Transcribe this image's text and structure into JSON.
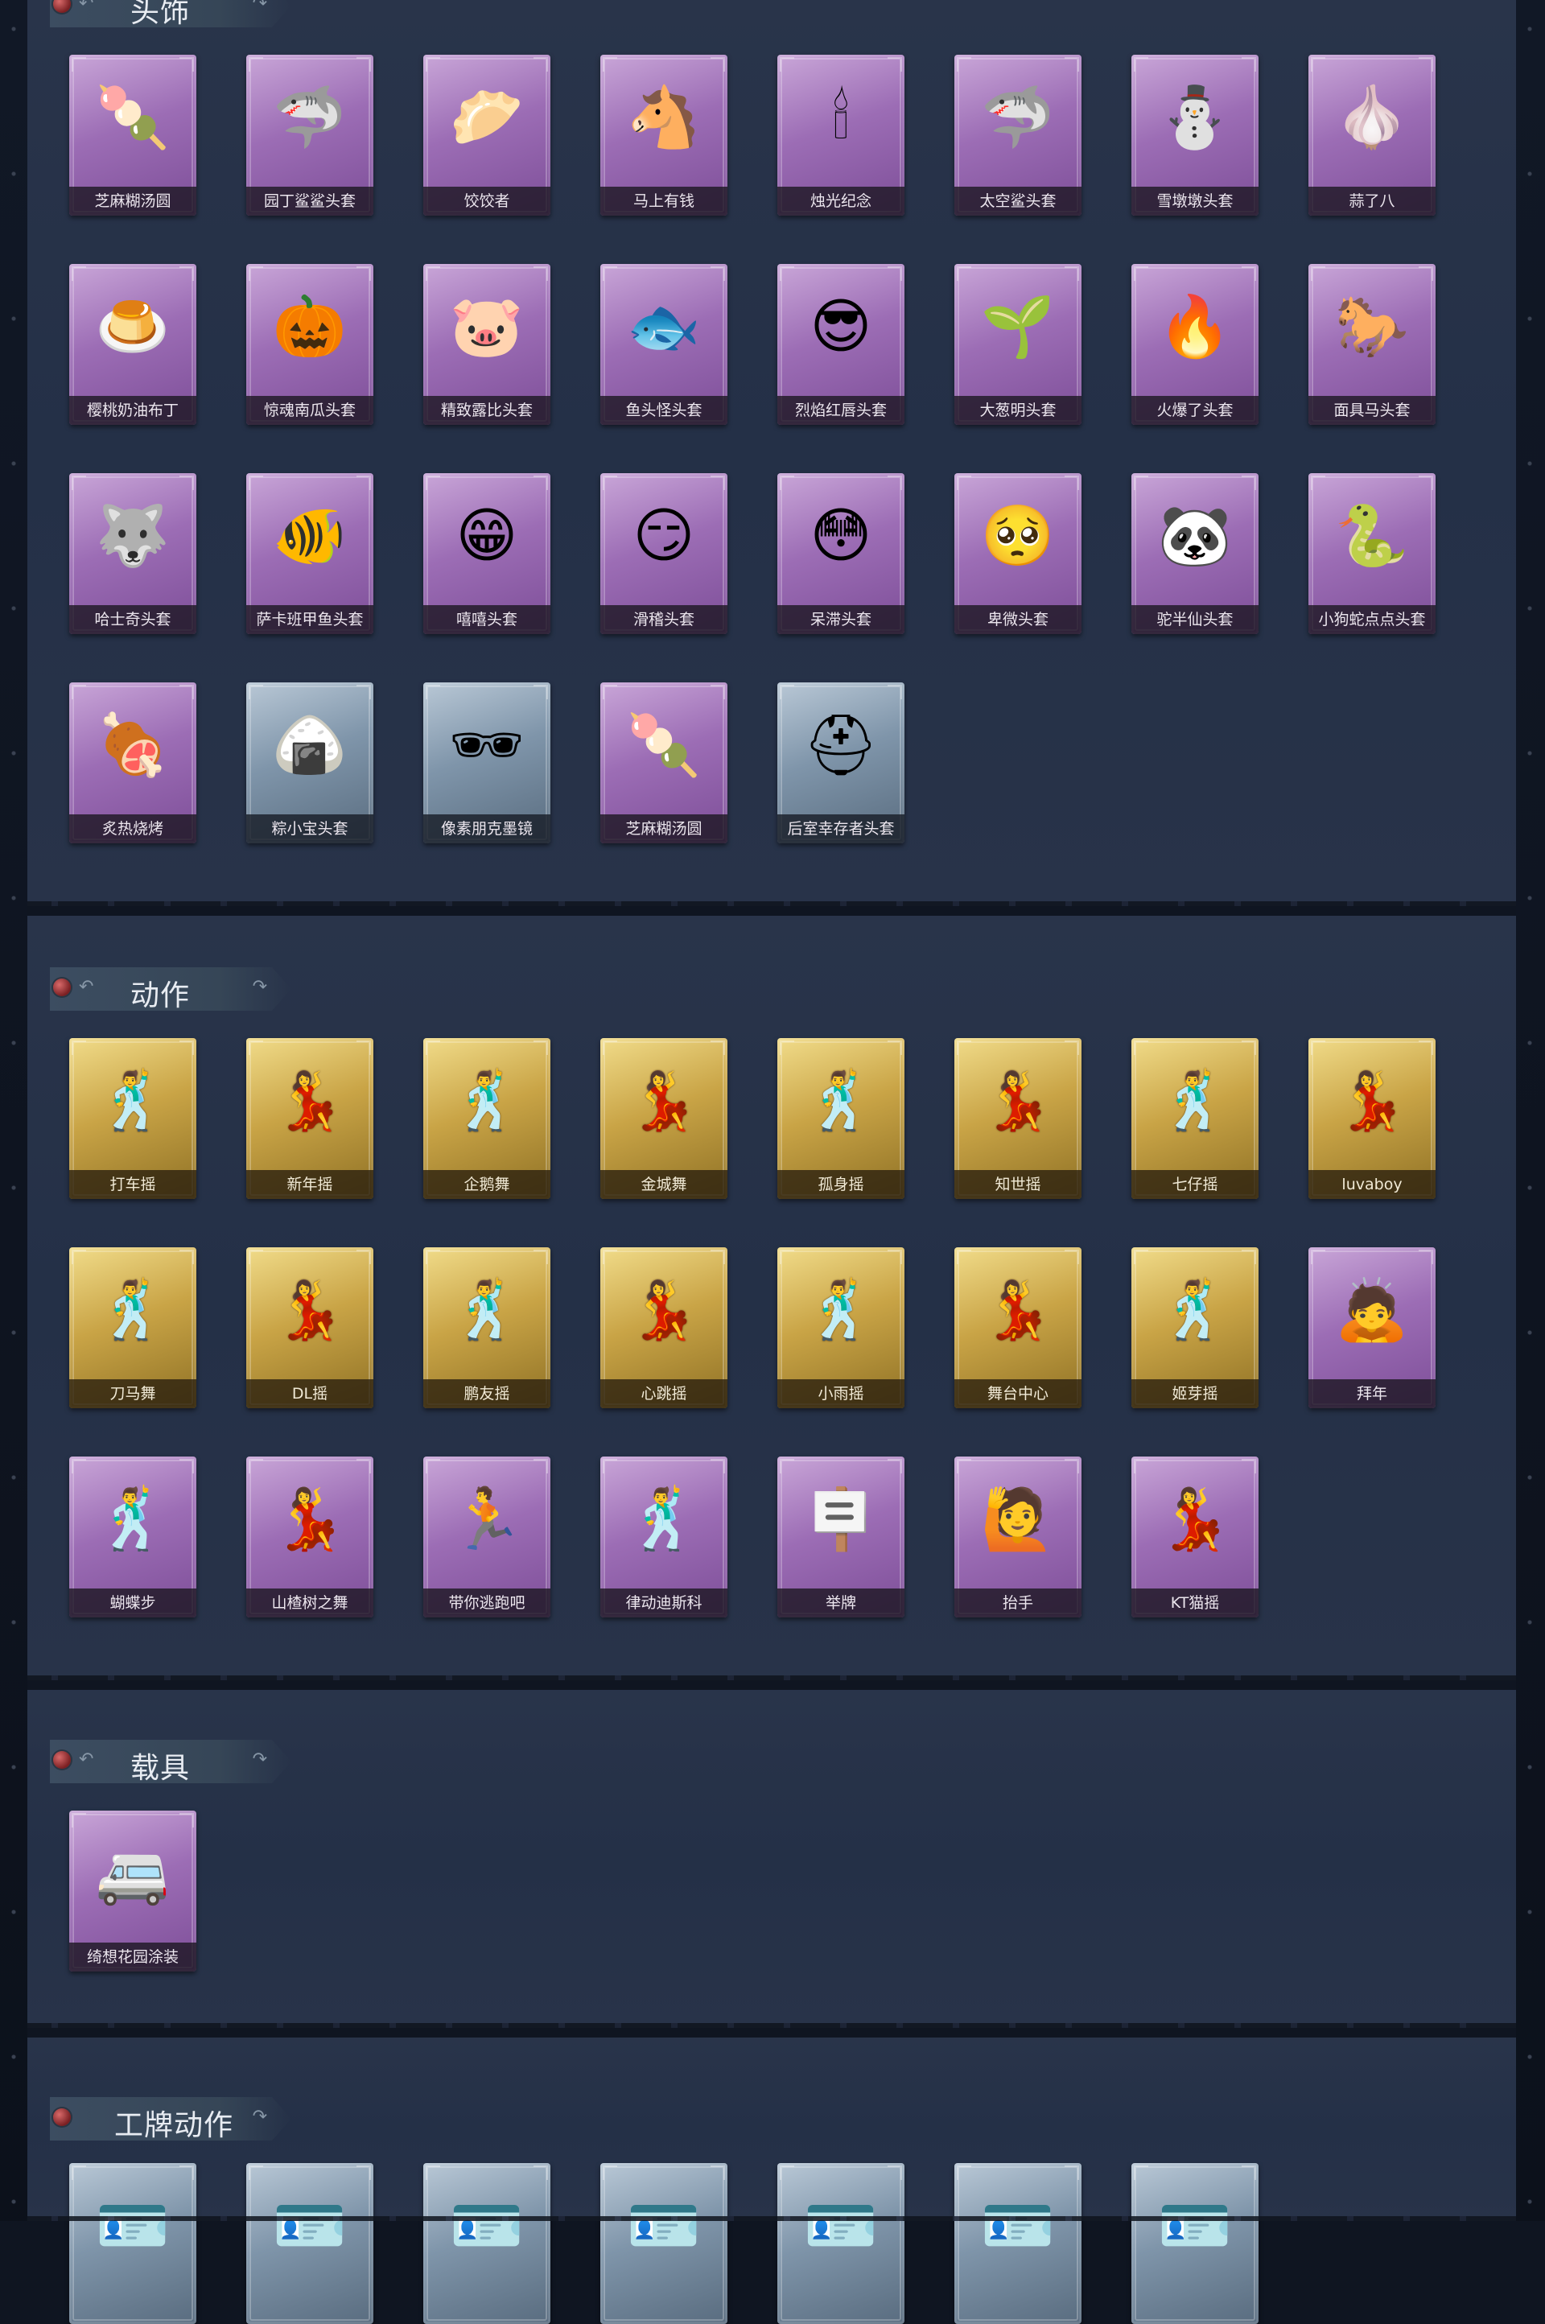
{
  "sections": [
    {
      "title": "头饰",
      "items": [
        {
          "label": "芝麻糊汤圆",
          "rarity": "purple",
          "icon": "dumpling-icon",
          "glyph": "🍡"
        },
        {
          "label": "园丁鲨鲨头套",
          "rarity": "purple",
          "icon": "shark-icon",
          "glyph": "🦈"
        },
        {
          "label": "饺饺者",
          "rarity": "purple",
          "icon": "dumpling-cloud-icon",
          "glyph": "🥟"
        },
        {
          "label": "马上有钱",
          "rarity": "purple",
          "icon": "horse-icon",
          "glyph": "🐴"
        },
        {
          "label": "烛光纪念",
          "rarity": "purple",
          "icon": "candle-icon",
          "glyph": "🕯"
        },
        {
          "label": "太空鲨头套",
          "rarity": "purple",
          "icon": "space-shark-icon",
          "glyph": "🦈"
        },
        {
          "label": "雪墩墩头套",
          "rarity": "purple",
          "icon": "snowman-icon",
          "glyph": "⛄"
        },
        {
          "label": "蒜了八",
          "rarity": "purple",
          "icon": "garlic-icon",
          "glyph": "🧄"
        },
        {
          "label": "樱桃奶油布丁",
          "rarity": "purple",
          "icon": "pudding-icon",
          "glyph": "🍮"
        },
        {
          "label": "惊魂南瓜头套",
          "rarity": "purple",
          "icon": "pumpkin-icon",
          "glyph": "🎃"
        },
        {
          "label": "精致露比头套",
          "rarity": "purple",
          "icon": "pink-bear-icon",
          "glyph": "🐷"
        },
        {
          "label": "鱼头怪头套",
          "rarity": "purple",
          "icon": "fish-head-icon",
          "glyph": "🐟"
        },
        {
          "label": "烈焰红唇头套",
          "rarity": "purple",
          "icon": "lips-icon",
          "glyph": "😎"
        },
        {
          "label": "大葱明头套",
          "rarity": "purple",
          "icon": "scallion-icon",
          "glyph": "🌱"
        },
        {
          "label": "火爆了头套",
          "rarity": "purple",
          "icon": "fire-icon",
          "glyph": "🔥"
        },
        {
          "label": "面具马头套",
          "rarity": "purple",
          "icon": "horse-mask-icon",
          "glyph": "🐎"
        },
        {
          "label": "哈士奇头套",
          "rarity": "purple",
          "icon": "husky-icon",
          "glyph": "🐺"
        },
        {
          "label": "萨卡班甲鱼头套",
          "rarity": "purple",
          "icon": "fish-icon",
          "glyph": "🐠"
        },
        {
          "label": "嘻嘻头套",
          "rarity": "purple",
          "icon": "grin-icon",
          "glyph": "😁"
        },
        {
          "label": "滑稽头套",
          "rarity": "purple",
          "icon": "funny-face-icon",
          "glyph": "😏"
        },
        {
          "label": "呆滞头套",
          "rarity": "purple",
          "icon": "dazed-face-icon",
          "glyph": "😳"
        },
        {
          "label": "卑微头套",
          "rarity": "purple",
          "icon": "humble-face-icon",
          "glyph": "🥺"
        },
        {
          "label": "驼半仙头套",
          "rarity": "purple",
          "icon": "alpaca-icon",
          "glyph": "🐼"
        },
        {
          "label": "小狗蛇点点头套",
          "rarity": "purple",
          "icon": "snake-icon",
          "glyph": "🐍"
        },
        {
          "label": "炙热烧烤",
          "rarity": "purple",
          "icon": "bbq-icon",
          "glyph": "🍖"
        },
        {
          "label": "粽小宝头套",
          "rarity": "blue",
          "icon": "zongzi-icon",
          "glyph": "🍙"
        },
        {
          "label": "像素朋克墨镜",
          "rarity": "blue",
          "icon": "pixel-sunglasses-icon",
          "glyph": "🕶"
        },
        {
          "label": "芝麻糊汤圆",
          "rarity": "purple",
          "icon": "dumpling-icon",
          "glyph": "🍡"
        },
        {
          "label": "后室幸存者头套",
          "rarity": "blue",
          "icon": "gas-mask-icon",
          "glyph": "⛑"
        }
      ]
    },
    {
      "title": "动作",
      "items": [
        {
          "label": "打车摇",
          "rarity": "gold",
          "icon": "dance-figure-icon",
          "glyph": "🕺"
        },
        {
          "label": "新年摇",
          "rarity": "gold",
          "icon": "dance-figure-icon",
          "glyph": "💃"
        },
        {
          "label": "企鹅舞",
          "rarity": "gold",
          "icon": "dance-figure-icon",
          "glyph": "🕺"
        },
        {
          "label": "金城舞",
          "rarity": "gold",
          "icon": "dance-figure-icon",
          "glyph": "💃"
        },
        {
          "label": "孤身摇",
          "rarity": "gold",
          "icon": "dance-figure-icon",
          "glyph": "🕺"
        },
        {
          "label": "知世摇",
          "rarity": "gold",
          "icon": "dance-figure-icon",
          "glyph": "💃"
        },
        {
          "label": "七仔摇",
          "rarity": "gold",
          "icon": "dance-figure-icon",
          "glyph": "🕺"
        },
        {
          "label": "luvaboy",
          "rarity": "gold",
          "icon": "dance-figure-icon",
          "glyph": "💃"
        },
        {
          "label": "刀马舞",
          "rarity": "gold",
          "icon": "dance-figure-icon",
          "glyph": "🕺"
        },
        {
          "label": "DL摇",
          "rarity": "gold",
          "icon": "dance-figure-icon",
          "glyph": "💃"
        },
        {
          "label": "鹏友摇",
          "rarity": "gold",
          "icon": "dance-figure-icon",
          "glyph": "🕺"
        },
        {
          "label": "心跳摇",
          "rarity": "gold",
          "icon": "dance-figure-icon",
          "glyph": "💃"
        },
        {
          "label": "小雨摇",
          "rarity": "gold",
          "icon": "dance-figure-icon",
          "glyph": "🕺"
        },
        {
          "label": "舞台中心",
          "rarity": "gold",
          "icon": "dance-figure-icon",
          "glyph": "💃"
        },
        {
          "label": "姬芽摇",
          "rarity": "gold",
          "icon": "dance-figure-icon",
          "glyph": "🕺"
        },
        {
          "label": "拜年",
          "rarity": "purple",
          "icon": "bow-figure-icon",
          "glyph": "🙇"
        },
        {
          "label": "蝴蝶步",
          "rarity": "purple",
          "icon": "dance-figure-icon",
          "glyph": "🕺"
        },
        {
          "label": "山楂树之舞",
          "rarity": "purple",
          "icon": "dance-figure-icon",
          "glyph": "💃"
        },
        {
          "label": "带你逃跑吧",
          "rarity": "purple",
          "icon": "run-figure-icon",
          "glyph": "🏃"
        },
        {
          "label": "律动迪斯科",
          "rarity": "purple",
          "icon": "disco-figure-icon",
          "glyph": "🕺"
        },
        {
          "label": "举牌",
          "rarity": "purple",
          "icon": "sign-figure-icon",
          "glyph": "🪧"
        },
        {
          "label": "抬手",
          "rarity": "purple",
          "icon": "raise-hand-icon",
          "glyph": "🙋"
        },
        {
          "label": "KT猫摇",
          "rarity": "purple",
          "icon": "dance-figure-icon",
          "glyph": "💃"
        }
      ]
    },
    {
      "title": "载具",
      "items": [
        {
          "label": "绮想花园涂装",
          "rarity": "purple",
          "icon": "vehicle-icon",
          "glyph": "🚐"
        }
      ]
    },
    {
      "title": "工牌动作",
      "items": [
        {
          "label": "",
          "rarity": "blue",
          "icon": "badge-icon",
          "glyph": "🪪"
        },
        {
          "label": "",
          "rarity": "blue",
          "icon": "badge-icon",
          "glyph": "🪪"
        },
        {
          "label": "",
          "rarity": "blue",
          "icon": "badge-icon",
          "glyph": "🪪"
        },
        {
          "label": "",
          "rarity": "blue",
          "icon": "badge-icon",
          "glyph": "🪪"
        },
        {
          "label": "",
          "rarity": "blue",
          "icon": "badge-icon",
          "glyph": "🪪"
        },
        {
          "label": "",
          "rarity": "blue",
          "icon": "badge-icon",
          "glyph": "🪪"
        },
        {
          "label": "",
          "rarity": "blue",
          "icon": "badge-icon",
          "glyph": "🪪"
        }
      ]
    }
  ],
  "colors": {
    "background": "#0f1521",
    "panel": "#263148",
    "rarity_purple": "#9c6db5",
    "rarity_gold": "#c9a446",
    "rarity_blue": "#7f95aa"
  }
}
